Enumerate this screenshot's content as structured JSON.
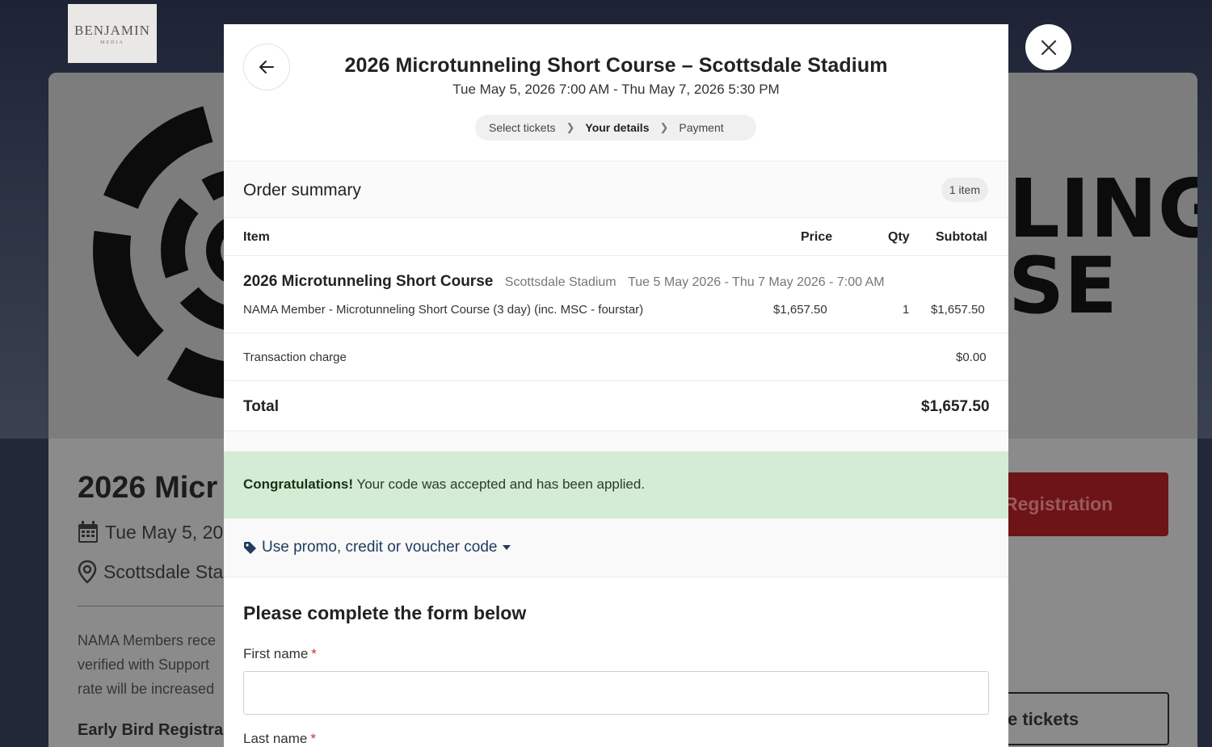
{
  "background": {
    "logo": {
      "main": "BENJAMIN",
      "sub": "MEDIA"
    },
    "banner_text_1": "LING",
    "banner_text_2": "SE",
    "event_title": "2026 Micr",
    "event_date": "Tue May 5, 202",
    "event_location": "Scottsdale Stad",
    "desc_lines": [
      "NAMA Members rece",
      "verified with Support",
      "rate will be increased"
    ],
    "early_bird": "Early Bird Registra",
    "registration_button": "Registration",
    "tickets_button": "e tickets"
  },
  "modal": {
    "title": "2026 Microtunneling Short Course – Scottsdale Stadium",
    "date_range": "Tue May 5, 2026 7:00 AM - Thu May 7, 2026 5:30 PM",
    "steps": [
      {
        "label": "Select tickets",
        "active": false
      },
      {
        "label": "Your details",
        "active": true
      },
      {
        "label": "Payment",
        "active": false
      }
    ],
    "order_summary": {
      "title": "Order summary",
      "item_count": "1 item",
      "columns": {
        "item": "Item",
        "price": "Price",
        "qty": "Qty",
        "subtotal": "Subtotal"
      },
      "course_name": "2026 Microtunneling Short Course",
      "course_venue": "Scottsdale Stadium",
      "course_dates": "Tue 5 May 2026 - Thu 7 May 2026 - 7:00 AM",
      "ticket": {
        "name": "NAMA Member - Microtunneling Short Course (3 day) (inc. MSC - fourstar)",
        "price": "$1,657.50",
        "qty": "1",
        "subtotal": "$1,657.50"
      },
      "transaction_label": "Transaction charge",
      "transaction_value": "$0.00",
      "total_label": "Total",
      "total_value": "$1,657.50"
    },
    "alert": {
      "strong": "Congratulations!",
      "text": " Your code was accepted and has been applied."
    },
    "promo_link": "Use promo, credit or voucher code",
    "form": {
      "title": "Please complete the form below",
      "first_name_label": "First name",
      "last_name_label": "Last name",
      "required_mark": "*",
      "first_name_value": ""
    }
  },
  "colors": {
    "alert_bg": "#d4ebd4",
    "promo_link": "#1f3b5f",
    "required": "#c0392b",
    "registration_btn": "#6d1416"
  },
  "icons": [
    "arrow-left-icon",
    "close-icon",
    "chevron-right-icon",
    "tag-icon",
    "caret-down-icon",
    "calendar-icon",
    "map-pin-icon"
  ]
}
